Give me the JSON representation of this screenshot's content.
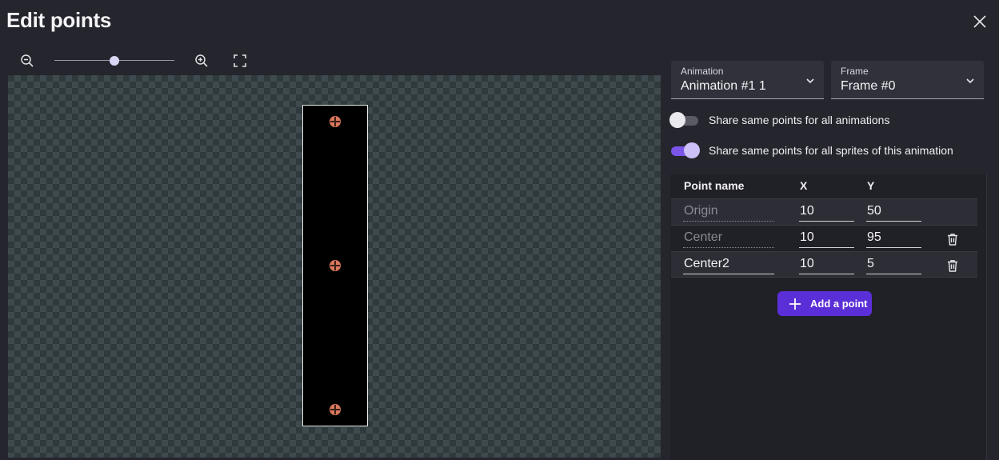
{
  "dialog": {
    "title": "Edit points"
  },
  "zoom": {
    "level": 0.5
  },
  "animation_select": {
    "label": "Animation",
    "value": "Animation #1 1"
  },
  "frame_select": {
    "label": "Frame",
    "value": "Frame #0"
  },
  "toggles": [
    {
      "label": "Share same points for all animations",
      "on": false
    },
    {
      "label": "Share same points for all sprites of this animation",
      "on": true
    }
  ],
  "table": {
    "headers": {
      "name": "Point name",
      "x": "X",
      "y": "Y"
    },
    "rows": [
      {
        "name": "Origin",
        "x": "10",
        "y": "50"
      },
      {
        "name": "Center",
        "x": "10",
        "y": "95"
      },
      {
        "name": "Center2",
        "x": "10",
        "y": "5"
      }
    ]
  },
  "add_point_label": "Add a point",
  "colors": {
    "accent": "#5b2fd8",
    "toggle_on": "#7a55e8",
    "point_marker": "#d9785c"
  },
  "icons": [
    "zoom-out-icon",
    "zoom-in-icon",
    "fit-screen-icon",
    "close-icon",
    "chevron-down-icon",
    "trash-icon",
    "plus-icon"
  ]
}
